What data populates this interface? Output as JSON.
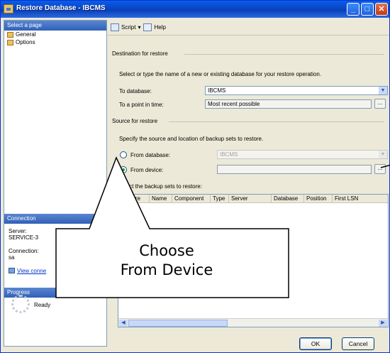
{
  "window": {
    "title": "Restore Database - IBCMS"
  },
  "left_pane": {
    "select_page_header": "Select a page",
    "pages": [
      "General",
      "Options"
    ],
    "connection_header": "Connection",
    "server_label": "Server:",
    "server_value": "SERVICE-3",
    "connection_label": "Connection:",
    "connection_value": "sa",
    "view_link": "View conne",
    "progress_header": "Progress",
    "progress_status": "Ready"
  },
  "toolbar": {
    "script_label": "Script",
    "help_label": "Help"
  },
  "destination": {
    "group_label": "Destination for restore",
    "instruction": "Select or type the name of a new or existing database for your restore operation.",
    "to_database_label": "To database:",
    "to_database_value": "IBCMS",
    "point_in_time_label": "To a point in time:",
    "point_in_time_value": "Most recent possible"
  },
  "source": {
    "group_label": "Source for restore",
    "instruction": "Specify the source and location of backup sets to restore.",
    "from_database_label": "From database:",
    "from_database_value": "IBCMS",
    "from_device_label": "From device:",
    "from_device_value": "",
    "select_sets_label": "lect the backup sets to restore:"
  },
  "grid": {
    "columns": [
      "Restore",
      "Name",
      "Component",
      "Type",
      "Server",
      "Database",
      "Position",
      "First LSN"
    ]
  },
  "buttons": {
    "ok": "OK",
    "cancel": "Cancel",
    "ellipsis": "..."
  },
  "callout": {
    "line1": "Choose",
    "line2": "From Device"
  }
}
